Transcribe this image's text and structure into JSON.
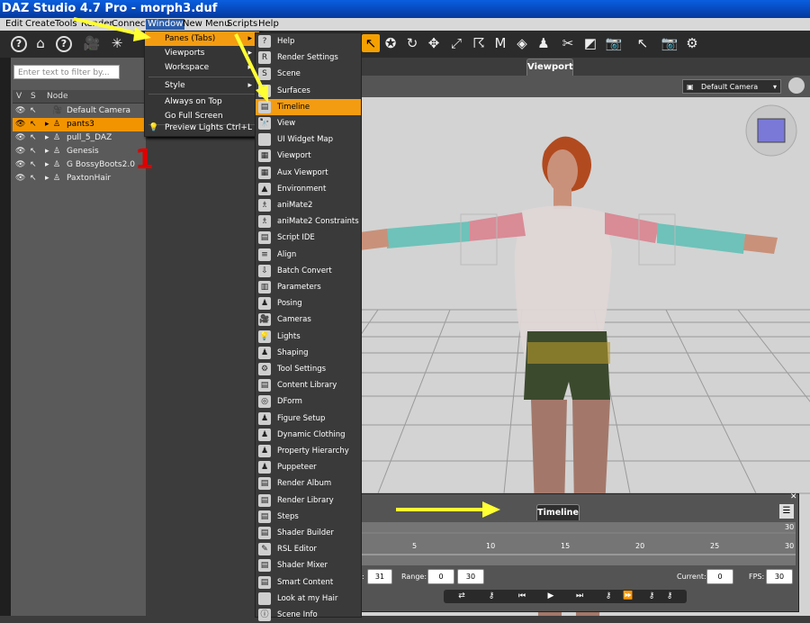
{
  "window": {
    "title": "DAZ Studio 4.7 Pro - morph3.duf"
  },
  "menubar": {
    "items": [
      "Edit",
      "Create",
      "Tools",
      "Render",
      "Connect",
      "Window",
      "New Menu",
      "Scripts",
      "Help"
    ]
  },
  "scene": {
    "filter_placeholder": "Enter text to filter by...",
    "columns": {
      "v": "V",
      "s": "S",
      "node": "Node"
    },
    "nodes": [
      "Default Camera",
      "pants3",
      "pull_5_DAZ",
      "Genesis",
      "G BossyBoots2.0",
      "PaxtonHair"
    ]
  },
  "window_menu": {
    "items": [
      {
        "label": "Panes (Tabs)",
        "shortcut": ""
      },
      {
        "label": "Viewports",
        "shortcut": ""
      },
      {
        "label": "Workspace",
        "shortcut": ""
      },
      {
        "label": "Style",
        "shortcut": ""
      },
      {
        "label": "Always on Top",
        "shortcut": ""
      },
      {
        "label": "Go Full Screen",
        "shortcut": ""
      },
      {
        "label": "Preview Lights",
        "shortcut": "Ctrl+L"
      }
    ]
  },
  "panes_menu": {
    "items": [
      "Help",
      "Render Settings",
      "Scene",
      "Surfaces",
      "Timeline",
      "View",
      "UI Widget Map",
      "Viewport",
      "Aux Viewport",
      "Environment",
      "aniMate2",
      "aniMate2 Constraints",
      "Script IDE",
      "Align",
      "Batch Convert",
      "Parameters",
      "Posing",
      "Cameras",
      "Lights",
      "Shaping",
      "Tool Settings",
      "Content Library",
      "DForm",
      "Figure Setup",
      "Dynamic Clothing",
      "Property Hierarchy",
      "Puppeteer",
      "Render Album",
      "Render Library",
      "Steps",
      "Shader Builder",
      "RSL Editor",
      "Shader Mixer",
      "Smart Content",
      "Look at my Hair",
      "Scene Info"
    ],
    "icons": [
      "?",
      "R",
      "S",
      "◆",
      "▤",
      "🔭",
      "",
      "▦",
      "▦",
      "▲",
      "♗",
      "♗",
      "▤",
      "≡",
      "⇩",
      "▥",
      "♟",
      "🎥",
      "💡",
      "♟",
      "⚙",
      "▤",
      "◎",
      "♟",
      "♟",
      "♟",
      "♟",
      "▤",
      "▤",
      "▤",
      "▤",
      "✎",
      "▤",
      "▤",
      "",
      "ⓘ"
    ]
  },
  "viewport": {
    "tab": "Viewport",
    "camera": "Default Camera"
  },
  "timeline": {
    "tab": "Timeline",
    "ticks": [
      "5",
      "10",
      "15",
      "20",
      "25",
      "30"
    ],
    "end_top": "30",
    "end_label": "31",
    "range_label": "Range:",
    "range_start": "0",
    "range_end": "30",
    "current_label": "Current:",
    "current_value": "0",
    "fps_label": "FPS:",
    "fps_value": "30"
  },
  "annotation": {
    "number": "1"
  },
  "colors": {
    "highlight": "#f39c12",
    "annotation_red": "#e00000",
    "arrow_yellow": "#ffff33"
  }
}
